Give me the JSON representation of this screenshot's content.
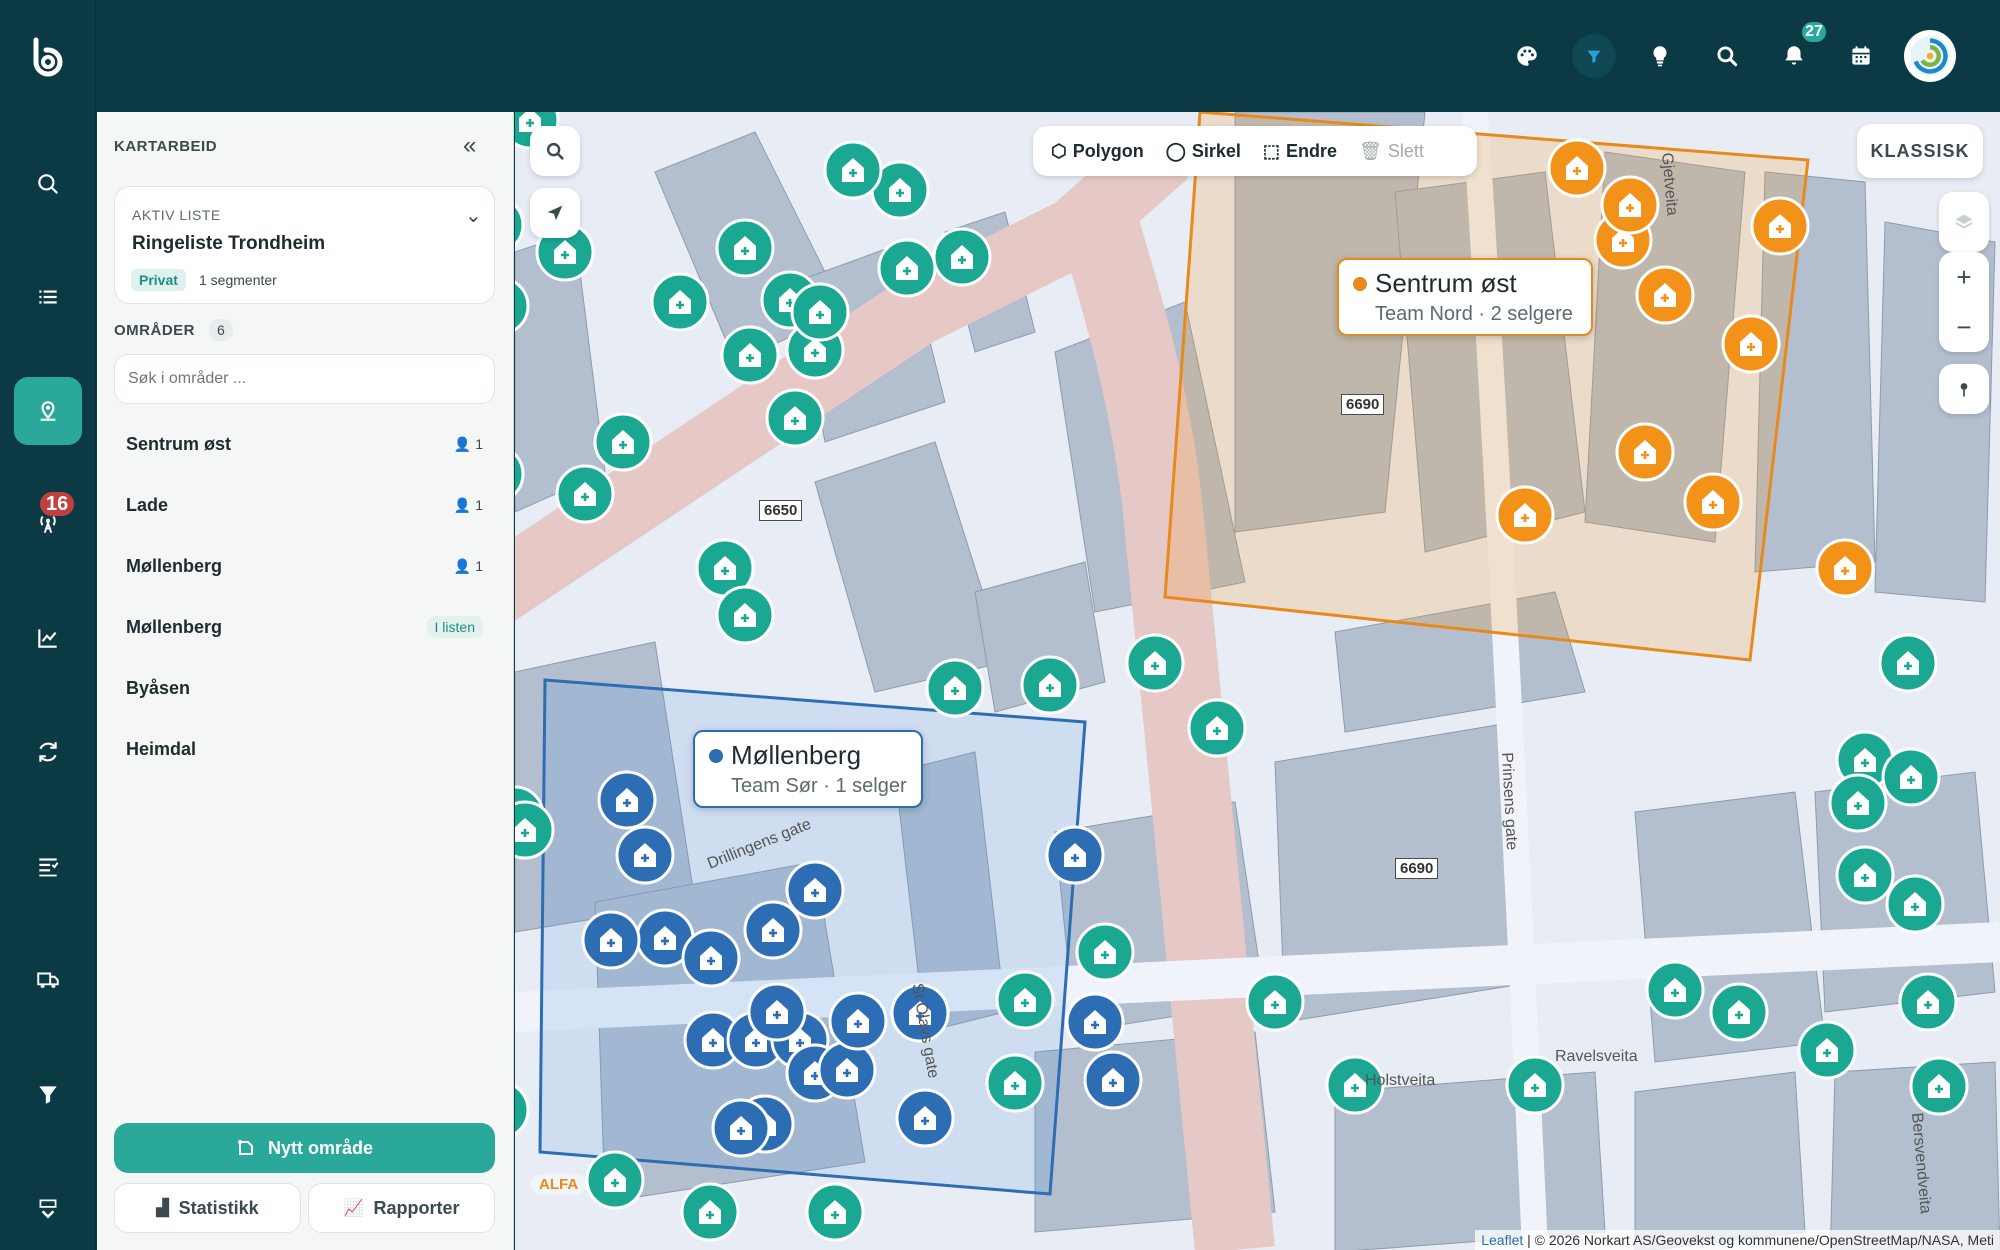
{
  "topbar": {
    "notification_count": "27",
    "icons": [
      "palette-icon",
      "filter-icon",
      "lightbulb-icon",
      "search-icon",
      "bell-icon",
      "calendar-icon"
    ]
  },
  "rail": {
    "items": [
      "search-icon",
      "list-icon",
      "map-pin-icon",
      "antenna-icon",
      "chart-icon",
      "refresh-icon",
      "task-list-icon",
      "truck-icon",
      "filter-icon"
    ],
    "active": "map-pin-icon",
    "antenna_badge": "16"
  },
  "panel": {
    "title": "KARTARBEID",
    "active_list": {
      "label": "AKTIV LISTE",
      "name": "Ringeliste Trondheim",
      "tag": "Privat",
      "segments": "1 segmenter"
    },
    "areas_label": "OMRÅDER",
    "areas_count": "6",
    "search_placeholder": "Søk i områder ...",
    "areas": [
      {
        "name": "Sentrum øst",
        "count": "1",
        "status": ""
      },
      {
        "name": "Lade",
        "count": "1",
        "status": ""
      },
      {
        "name": "Møllenberg",
        "count": "1",
        "status": ""
      },
      {
        "name": "Møllenberg",
        "count": "",
        "status": "I listen"
      },
      {
        "name": "Byåsen",
        "count": "",
        "status": ""
      },
      {
        "name": "Heimdal",
        "count": "",
        "status": ""
      }
    ],
    "new_area_label": "Nytt område",
    "stats_label": "Statistikk",
    "reports_label": "Rapporter"
  },
  "map": {
    "tools": {
      "polygon": "Polygon",
      "circle": "Sirkel",
      "edit": "Endre",
      "delete": "Slett"
    },
    "mode_label": "KLASSISK",
    "callout_east": {
      "title": "Sentrum øst",
      "subtitle": "Team Nord · 2 selgere",
      "color": "#e8891c"
    },
    "callout_moll": {
      "title": "Møllenberg",
      "subtitle": "Team Sør · 1 selger",
      "color": "#2d6db3"
    },
    "road_labels": [
      "6650",
      "6690",
      "6690"
    ],
    "street_names": [
      "Prinsens gate",
      "Gjetveita",
      "St Olavs gate",
      "Holstveita",
      "Ravelsveita",
      "Bersvendveita",
      "Drillingens gate"
    ],
    "attribution_leaflet": "Leaflet",
    "attribution": " | © 2026 Norkart AS/Geovekst og kommunene/OpenStreetMap/NASA, Meti",
    "alfa_label": "ALFA",
    "marker_colors": {
      "teal": "#1aa893",
      "orange": "#f29218",
      "blue": "#2d6db3"
    }
  }
}
